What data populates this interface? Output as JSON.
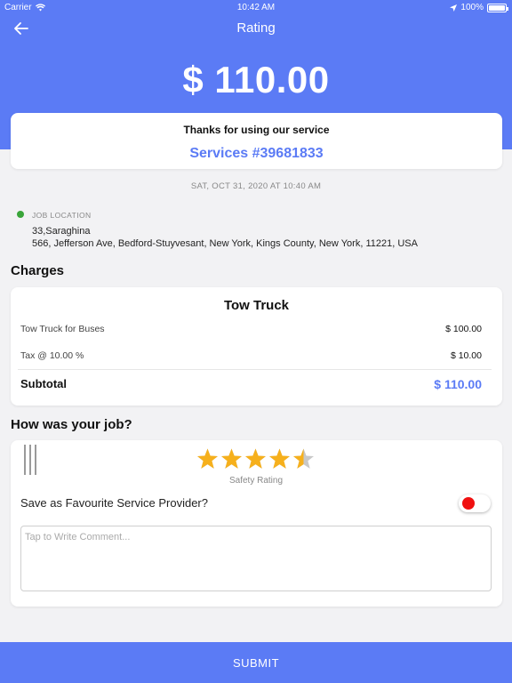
{
  "status_bar": {
    "carrier": "Carrier",
    "time": "10:42 AM",
    "battery": "100%"
  },
  "nav": {
    "title": "Rating",
    "back_icon": "back-arrow-icon"
  },
  "amount": "$ 110.00",
  "summary": {
    "thanks": "Thanks for using our service",
    "service_number": "Services #39681833"
  },
  "date": "SAT, OCT 31, 2020 AT 10:40 AM",
  "location": {
    "label": "JOB LOCATION",
    "name": "33,Saraghina",
    "address": "566, Jefferson Ave, Bedford-Stuyvesant, New York, Kings County, New York, 11221, USA"
  },
  "charges": {
    "title": "Charges",
    "heading": "Tow Truck",
    "rows": [
      {
        "label": "Tow Truck for Buses",
        "value": "$ 100.00"
      },
      {
        "label": "Tax @ 10.00 %",
        "value": "$ 10.00"
      }
    ],
    "subtotal_label": "Subtotal",
    "subtotal_value": "$ 110.00"
  },
  "rating": {
    "title": "How was your job?",
    "stars_value": 4.5,
    "stars_max": 5,
    "safety_label": "Safety Rating",
    "favourite_label": "Save as Favourite Service Provider?",
    "favourite_on": false,
    "comment_placeholder": "Tap to Write Comment..."
  },
  "submit_label": "SUBMIT",
  "colors": {
    "accent": "#5b7bf5",
    "star": "#f6b01c",
    "toggle_knob": "#f01010",
    "location_dot": "#3aa53a"
  }
}
